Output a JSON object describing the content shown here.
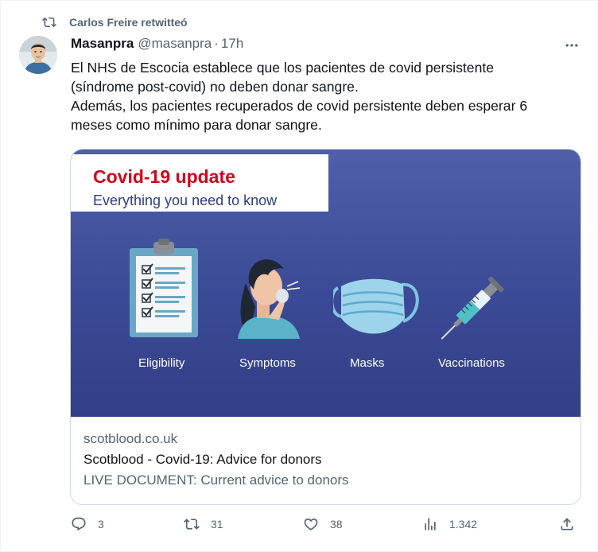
{
  "retweet": {
    "text": "Carlos Freire retwitteó",
    "icon": "retweet-icon"
  },
  "author": {
    "name": "Masanpra",
    "handle": "@masanpra",
    "separator": "·",
    "time": "17h"
  },
  "tweet": {
    "line1": "El NHS de Escocia establece que los pacientes de covid persistente",
    "line2": "(síndrome post-covid) no deben donar sangre.",
    "line3": "Además, los pacientes recuperados de covid persistente deben esperar 6",
    "line4": "meses como mínimo para donar sangre."
  },
  "card": {
    "banner_title": "Covid-19 update",
    "banner_subtitle": "Everything you need to know",
    "captions": [
      "Eligibility",
      "Symptoms",
      "Masks",
      "Vaccinations"
    ],
    "domain": "scotblood.co.uk",
    "title": "Scotblood - Covid-19: Advice for donors",
    "description": "LIVE DOCUMENT: Current advice to donors"
  },
  "actions": {
    "reply_count": "3",
    "retweet_count": "31",
    "like_count": "38",
    "views_count": "1.342"
  },
  "colors": {
    "text_secondary": "#536471",
    "banner_red": "#d0021b",
    "card_bg": "#3b4a96"
  }
}
